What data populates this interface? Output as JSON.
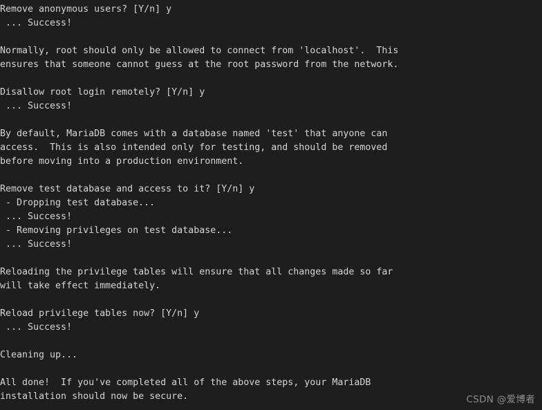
{
  "terminal": {
    "background_color": "#1e1e1e",
    "text_color": "#d6d6d6",
    "font_size_px": 13.3,
    "line_height_px": 20,
    "lines": [
      "Remove anonymous users? [Y/n] y",
      " ... Success!",
      "",
      "Normally, root should only be allowed to connect from 'localhost'.  This",
      "ensures that someone cannot guess at the root password from the network.",
      "",
      "Disallow root login remotely? [Y/n] y",
      " ... Success!",
      "",
      "By default, MariaDB comes with a database named 'test' that anyone can",
      "access.  This is also intended only for testing, and should be removed",
      "before moving into a production environment.",
      "",
      "Remove test database and access to it? [Y/n] y",
      " - Dropping test database...",
      " ... Success!",
      " - Removing privileges on test database...",
      " ... Success!",
      "",
      "Reloading the privilege tables will ensure that all changes made so far",
      "will take effect immediately.",
      "",
      "Reload privilege tables now? [Y/n] y",
      " ... Success!",
      "",
      "Cleaning up...",
      "",
      "All done!  If you've completed all of the above steps, your MariaDB",
      "installation should now be secure."
    ]
  },
  "watermark": {
    "text": "CSDN @爱博者",
    "color": "#8f8f8f"
  }
}
